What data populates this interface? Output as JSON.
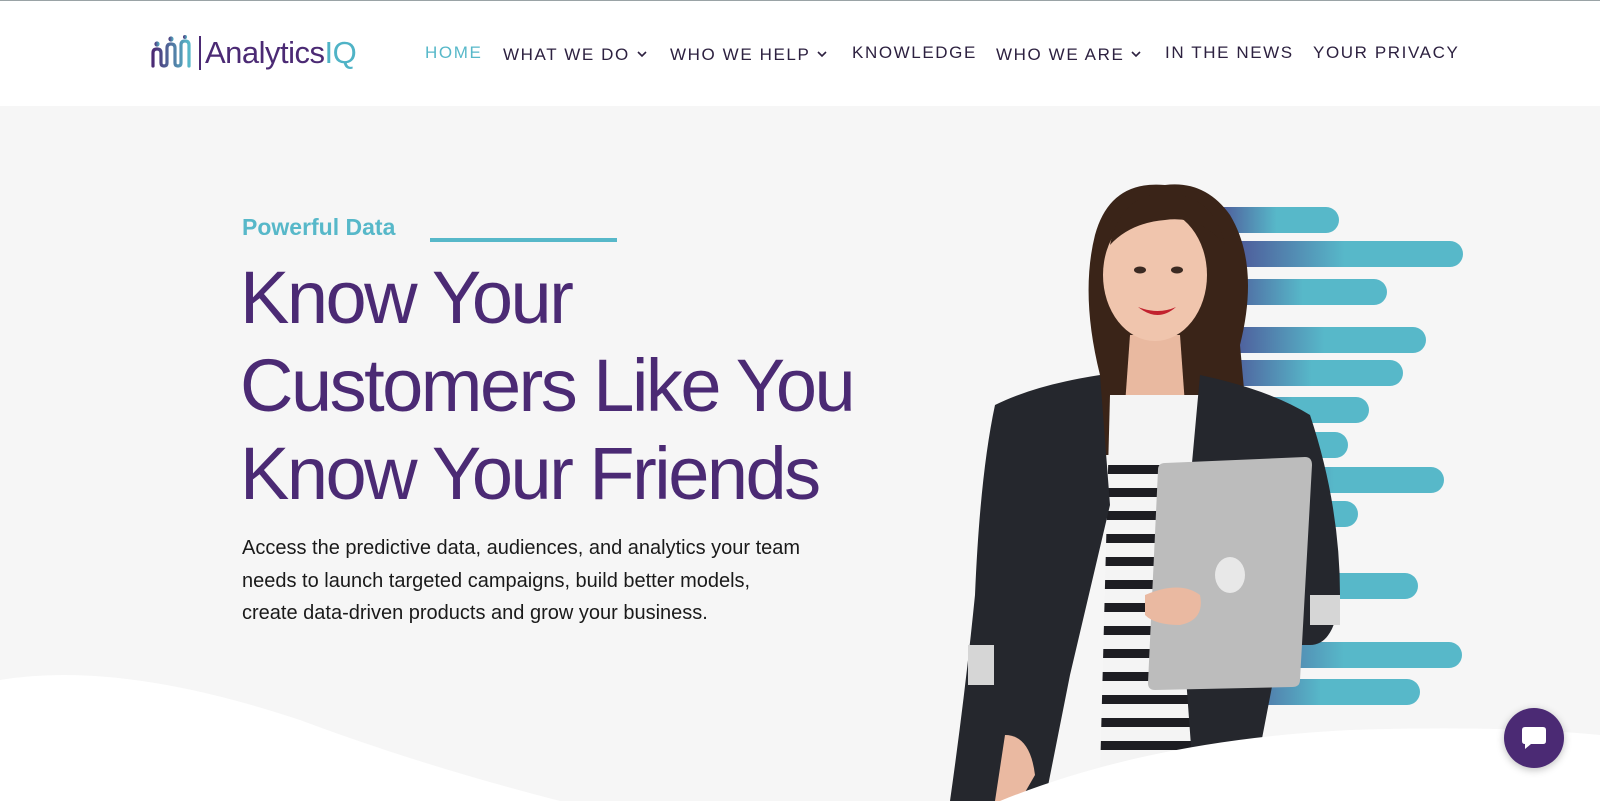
{
  "brand": {
    "name_part1": "Analytics",
    "name_part2": "IQ",
    "primary_color": "#4b2a74",
    "accent_color": "#57b8c9"
  },
  "nav": {
    "items": [
      {
        "label": "HOME",
        "active": true,
        "has_dropdown": false
      },
      {
        "label": "WHAT WE DO",
        "active": false,
        "has_dropdown": true
      },
      {
        "label": "WHO WE HELP",
        "active": false,
        "has_dropdown": true
      },
      {
        "label": "KNOWLEDGE",
        "active": false,
        "has_dropdown": false
      },
      {
        "label": "WHO WE ARE",
        "active": false,
        "has_dropdown": true
      },
      {
        "label": "IN THE NEWS",
        "active": false,
        "has_dropdown": false
      },
      {
        "label": "YOUR PRIVACY",
        "active": false,
        "has_dropdown": false
      }
    ]
  },
  "hero": {
    "eyebrow": "Powerful Data",
    "headline_lines": [
      "Know Your",
      "Customers Like You",
      "Know Your Friends"
    ],
    "body": "Access the predictive data, audiences, and analytics your team needs to launch targeted campaigns, build better models, create data-driven products and grow your business."
  },
  "icons": {
    "logo": "analyticsiq-people-logo-icon",
    "dropdown": "chevron-down-icon",
    "chat": "chat-bubble-icon"
  }
}
